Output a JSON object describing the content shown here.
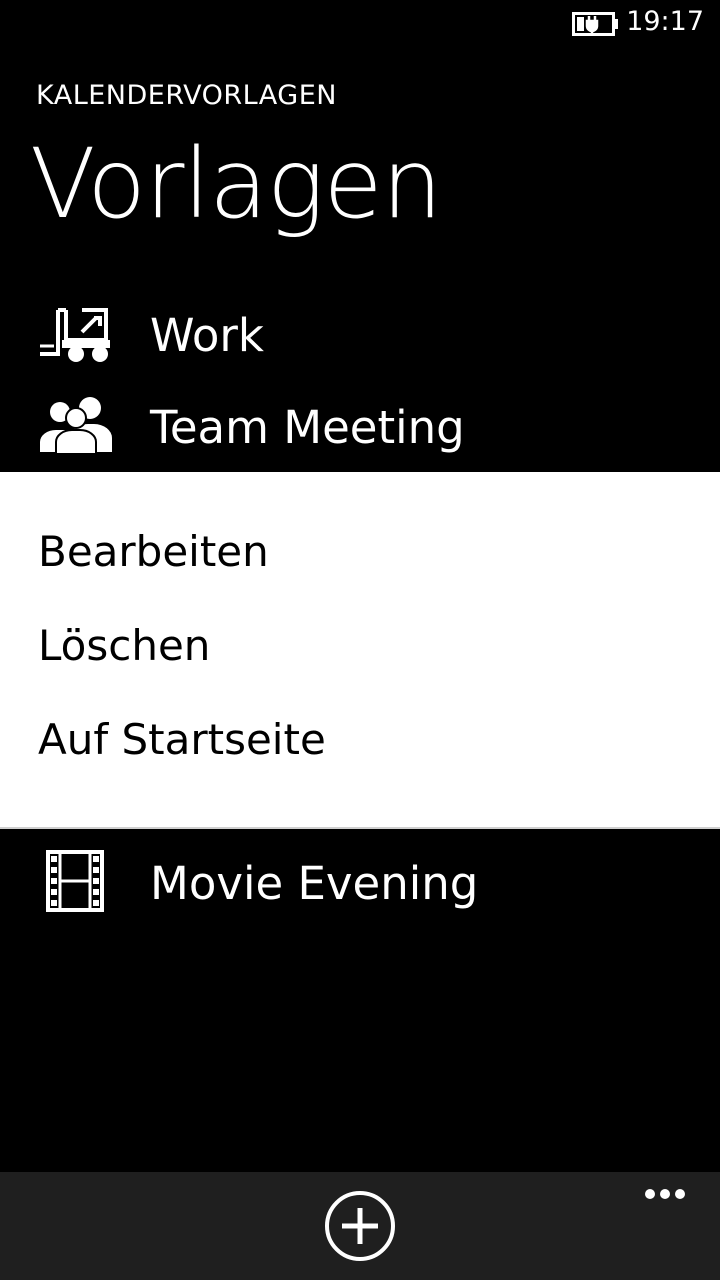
{
  "status_bar": {
    "time": "19:17",
    "battery_icon": "battery-charging-icon"
  },
  "header": {
    "app_title": "KALENDERVORLAGEN",
    "page_title": "Vorlagen"
  },
  "templates": [
    {
      "label": "Work",
      "icon": "forklift-icon"
    },
    {
      "label": "Team Meeting",
      "icon": "people-icon"
    },
    {
      "label": "Movie Evening",
      "icon": "film-icon"
    }
  ],
  "context_menu": {
    "items": [
      {
        "label": "Bearbeiten"
      },
      {
        "label": "Löschen"
      },
      {
        "label": "Auf Startseite"
      }
    ]
  },
  "app_bar": {
    "add_icon": "add-circle-icon",
    "more_icon": "more-ellipsis-icon",
    "background": "#1f1f1f"
  },
  "colors": {
    "background": "#000000",
    "foreground": "#ffffff",
    "menu_background": "#ffffff",
    "menu_text": "#000000"
  }
}
